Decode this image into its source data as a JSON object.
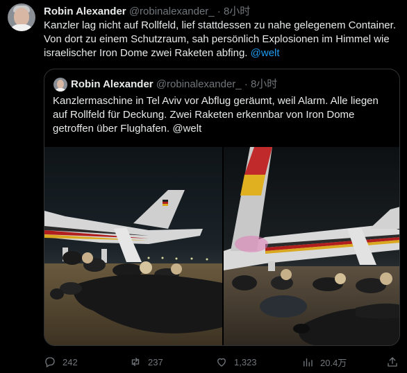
{
  "tweet": {
    "author_name": "Robin Alexander",
    "handle": "@robinalexander_",
    "separator": "·",
    "time": "8小时",
    "text": "Kanzler lag nicht auf Rollfeld, lief stattdessen zu nahe gelegenem Container. Von dort zu einem Schutzraum, sah persönlich Explosionen im Himmel wie israelischer Iron Dome zwei Raketen abfing. ",
    "text_link": "@welt"
  },
  "quoted": {
    "author_name": "Robin Alexander",
    "handle": "@robinalexander_",
    "separator": "·",
    "time": "8小时",
    "text": "Kanzlermaschine in Tel Aviv vor Abflug geräumt, weil Alarm. Alle liegen auf Rollfeld für Deckung. Zwei Raketen erkennbar von Iron Dome getroffen über Flughafen. @welt"
  },
  "actions": {
    "replies": "242",
    "retweets": "237",
    "likes": "1,323",
    "views": "20.4万",
    "icons": [
      "reply-icon",
      "retweet-icon",
      "like-icon",
      "views-icon",
      "share-icon"
    ]
  },
  "colors": {
    "background": "#000000",
    "text": "#e7e9ea",
    "muted": "#71767b",
    "link": "#1d9bf0",
    "border": "#2f3336"
  }
}
